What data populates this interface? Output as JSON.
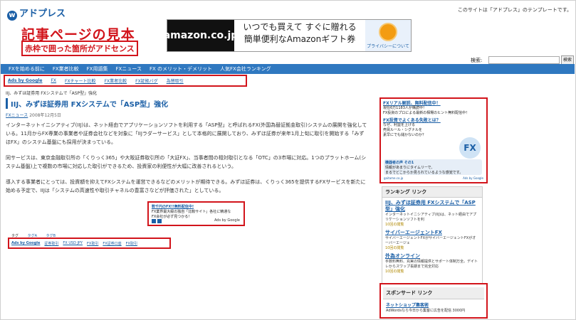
{
  "header": {
    "logo": "アドプレス",
    "logo_mark": "w",
    "top_note": "このサイトは「アドプレス」のテンプレートです。",
    "sample_title": "記事ページの見本",
    "sample_sub": "赤枠で囲った箇所がアドセンス"
  },
  "banner": {
    "brand": "amazon.co.jp",
    "line1": "いつでも買えて すぐに贈れる",
    "line2": "簡単便利なAmazonギフト券",
    "gift_caption": "プライバシーについて"
  },
  "search": {
    "label": "検索:",
    "button": "検索"
  },
  "nav": {
    "items": [
      "FXを始める前に",
      "FX業者比較",
      "FX用語集",
      "FXニュース",
      "FX のメリット・デメリット",
      "人気FX会社ランキング"
    ]
  },
  "adlinks_top": {
    "brand": "Ads by Google",
    "items": [
      "FX",
      "FXチャート比較",
      "FX業者比較",
      "FX証拠バグ",
      "為替取引"
    ]
  },
  "breadcrumb": "IIJ、みずほ証券用 FXシステムで「ASP型」強化",
  "article": {
    "title": "IIJ、みずほ証券用 FXシステムで「ASP型」強化",
    "category": "FXニュース",
    "date": "2008年12月5日",
    "p1": "インターネットイニシアティブ(IIJ)は、ネット経由でアプリケーションソフトを利用する「ASP型」と呼ばれるFX(外国為替証拠金取引)システムの展開を強化している。11月からFX専業の事業者や証券会社などを対象に「IIJラダーサービス」として本格的に展開しており、みずほ証券が来年1月上旬に取引を開始する「みずほFX」のシステム基盤にも採用が決まっている。",
    "p2": "同サービスは、東京金融取引所の「くりっく365」や大阪証券取引所の「大証FX」、当事者間の相対取引となる「OTC」の3市場に対応。1つのプラットホーム(システム基盤)上で複数の市場に対応した取引ができるため、投資家の利便性が大幅に改善されるという。",
    "p3": "導入する事業者にとっては、投資額を抑えてFXシステムを運営できるなどのメリットが期待できる。みずほ証券は、くりっく365を提供するFXサービスを新たに始める予定で、IIJは「システムの高速性や取引チャネルの豊富さなどが評価された」としている。"
  },
  "ad_box": {
    "title": "数千円のFX!!無料配信中!",
    "body1": "FX業界最大級の独自「比較サイト」各社に精通な",
    "body2": "FX会社が必ず見つかる！",
    "by": "Ads by Google"
  },
  "tags": {
    "items": [
      "タグ",
      "タグA",
      "タグB"
    ]
  },
  "adlinks_bottom": {
    "brand": "Ads by Google",
    "items": [
      "証券取引",
      "FX USD JPY",
      "FX取引",
      "FX証券口座",
      "FX取引"
    ]
  },
  "side_ad": {
    "t1": "FXリアル解説、無料配信中！",
    "d1": "現在6万1183人が購読中！",
    "d2": "FX投資のプロによる最新の相場のヒント無料配信中！",
    "t2": "FX投資でよくある失敗とは？",
    "d3": "なぜ、利益を上げる",
    "d4": "売買ルール・シグナルを",
    "d5": "素早にでも儲かないのか？",
    "fx_logo": "FX",
    "bubble_title": "機器者の声 その1",
    "bubble1": "情報があまりにタイムリーで、",
    "bubble2": "まるでどこからか見られているような感覚です。",
    "foot_left": "gaitame.co.jp",
    "foot_right": "Ads by Google"
  },
  "ranking": {
    "header": "ランキング リンク",
    "items": [
      {
        "title": "IIJ、みずほ証券用 FXシステムで「ASP型」強化",
        "desc": "インターネットイニシアティブ(IIJ)は、ネット経由でアプリケーションソフトを利",
        "count": "10回の閲覧"
      },
      {
        "title": "サイバーエージェントFX",
        "desc": "サイバーエージェントFXがサイバーエージェントFXがオーバーエージェ",
        "count": "10回の閲覧"
      },
      {
        "title": "外為オンライン",
        "desc": "手数料無料、充実の情報提供とサポート体制万全。デイトレからスワップ長期まで完全対応",
        "count": "10回の閲覧"
      }
    ]
  },
  "sponsor": {
    "header": "スポンサード リンク",
    "title": "ネットショップ集客術",
    "desc": "AdWordsなら今日から集客に広告を配信 3000円"
  }
}
